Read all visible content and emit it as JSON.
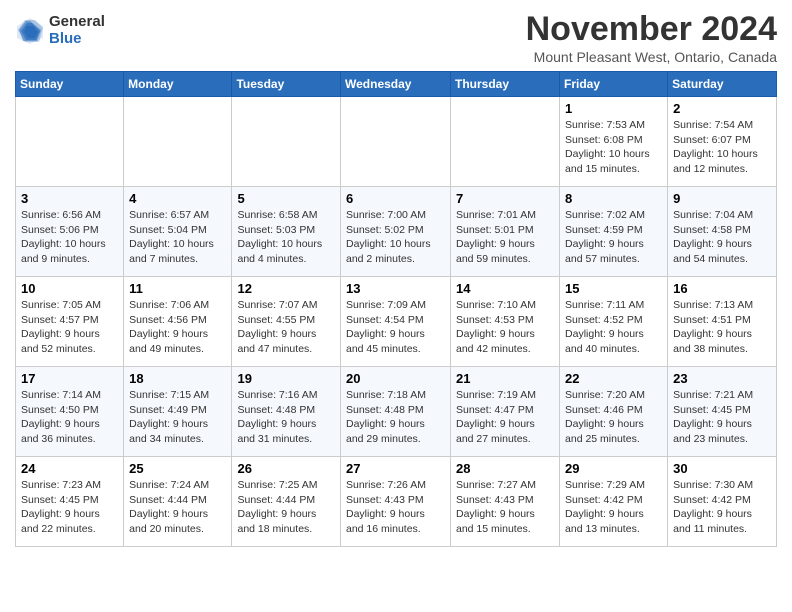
{
  "header": {
    "logo_general": "General",
    "logo_blue": "Blue",
    "month_title": "November 2024",
    "location": "Mount Pleasant West, Ontario, Canada"
  },
  "weekdays": [
    "Sunday",
    "Monday",
    "Tuesday",
    "Wednesday",
    "Thursday",
    "Friday",
    "Saturday"
  ],
  "weeks": [
    [
      {
        "day": "",
        "info": ""
      },
      {
        "day": "",
        "info": ""
      },
      {
        "day": "",
        "info": ""
      },
      {
        "day": "",
        "info": ""
      },
      {
        "day": "",
        "info": ""
      },
      {
        "day": "1",
        "info": "Sunrise: 7:53 AM\nSunset: 6:08 PM\nDaylight: 10 hours and 15 minutes."
      },
      {
        "day": "2",
        "info": "Sunrise: 7:54 AM\nSunset: 6:07 PM\nDaylight: 10 hours and 12 minutes."
      }
    ],
    [
      {
        "day": "3",
        "info": "Sunrise: 6:56 AM\nSunset: 5:06 PM\nDaylight: 10 hours and 9 minutes."
      },
      {
        "day": "4",
        "info": "Sunrise: 6:57 AM\nSunset: 5:04 PM\nDaylight: 10 hours and 7 minutes."
      },
      {
        "day": "5",
        "info": "Sunrise: 6:58 AM\nSunset: 5:03 PM\nDaylight: 10 hours and 4 minutes."
      },
      {
        "day": "6",
        "info": "Sunrise: 7:00 AM\nSunset: 5:02 PM\nDaylight: 10 hours and 2 minutes."
      },
      {
        "day": "7",
        "info": "Sunrise: 7:01 AM\nSunset: 5:01 PM\nDaylight: 9 hours and 59 minutes."
      },
      {
        "day": "8",
        "info": "Sunrise: 7:02 AM\nSunset: 4:59 PM\nDaylight: 9 hours and 57 minutes."
      },
      {
        "day": "9",
        "info": "Sunrise: 7:04 AM\nSunset: 4:58 PM\nDaylight: 9 hours and 54 minutes."
      }
    ],
    [
      {
        "day": "10",
        "info": "Sunrise: 7:05 AM\nSunset: 4:57 PM\nDaylight: 9 hours and 52 minutes."
      },
      {
        "day": "11",
        "info": "Sunrise: 7:06 AM\nSunset: 4:56 PM\nDaylight: 9 hours and 49 minutes."
      },
      {
        "day": "12",
        "info": "Sunrise: 7:07 AM\nSunset: 4:55 PM\nDaylight: 9 hours and 47 minutes."
      },
      {
        "day": "13",
        "info": "Sunrise: 7:09 AM\nSunset: 4:54 PM\nDaylight: 9 hours and 45 minutes."
      },
      {
        "day": "14",
        "info": "Sunrise: 7:10 AM\nSunset: 4:53 PM\nDaylight: 9 hours and 42 minutes."
      },
      {
        "day": "15",
        "info": "Sunrise: 7:11 AM\nSunset: 4:52 PM\nDaylight: 9 hours and 40 minutes."
      },
      {
        "day": "16",
        "info": "Sunrise: 7:13 AM\nSunset: 4:51 PM\nDaylight: 9 hours and 38 minutes."
      }
    ],
    [
      {
        "day": "17",
        "info": "Sunrise: 7:14 AM\nSunset: 4:50 PM\nDaylight: 9 hours and 36 minutes."
      },
      {
        "day": "18",
        "info": "Sunrise: 7:15 AM\nSunset: 4:49 PM\nDaylight: 9 hours and 34 minutes."
      },
      {
        "day": "19",
        "info": "Sunrise: 7:16 AM\nSunset: 4:48 PM\nDaylight: 9 hours and 31 minutes."
      },
      {
        "day": "20",
        "info": "Sunrise: 7:18 AM\nSunset: 4:48 PM\nDaylight: 9 hours and 29 minutes."
      },
      {
        "day": "21",
        "info": "Sunrise: 7:19 AM\nSunset: 4:47 PM\nDaylight: 9 hours and 27 minutes."
      },
      {
        "day": "22",
        "info": "Sunrise: 7:20 AM\nSunset: 4:46 PM\nDaylight: 9 hours and 25 minutes."
      },
      {
        "day": "23",
        "info": "Sunrise: 7:21 AM\nSunset: 4:45 PM\nDaylight: 9 hours and 23 minutes."
      }
    ],
    [
      {
        "day": "24",
        "info": "Sunrise: 7:23 AM\nSunset: 4:45 PM\nDaylight: 9 hours and 22 minutes."
      },
      {
        "day": "25",
        "info": "Sunrise: 7:24 AM\nSunset: 4:44 PM\nDaylight: 9 hours and 20 minutes."
      },
      {
        "day": "26",
        "info": "Sunrise: 7:25 AM\nSunset: 4:44 PM\nDaylight: 9 hours and 18 minutes."
      },
      {
        "day": "27",
        "info": "Sunrise: 7:26 AM\nSunset: 4:43 PM\nDaylight: 9 hours and 16 minutes."
      },
      {
        "day": "28",
        "info": "Sunrise: 7:27 AM\nSunset: 4:43 PM\nDaylight: 9 hours and 15 minutes."
      },
      {
        "day": "29",
        "info": "Sunrise: 7:29 AM\nSunset: 4:42 PM\nDaylight: 9 hours and 13 minutes."
      },
      {
        "day": "30",
        "info": "Sunrise: 7:30 AM\nSunset: 4:42 PM\nDaylight: 9 hours and 11 minutes."
      }
    ]
  ]
}
